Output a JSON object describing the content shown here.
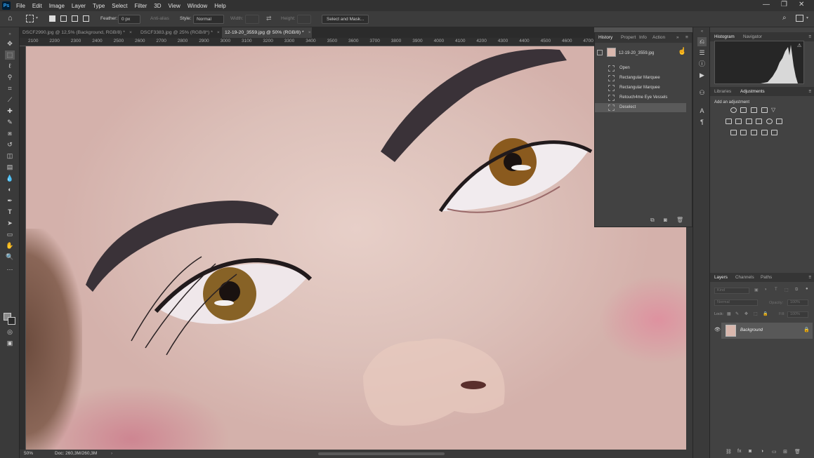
{
  "menubar": {
    "logo": "Ps",
    "items": [
      "File",
      "Edit",
      "Image",
      "Layer",
      "Type",
      "Select",
      "Filter",
      "3D",
      "View",
      "Window",
      "Help"
    ]
  },
  "options": {
    "feather_label": "Feather:",
    "feather_value": "0 px",
    "antialias_label": "Anti-alias",
    "style_label": "Style:",
    "style_value": "Normal",
    "width_label": "Width:",
    "height_label": "Height:",
    "select_mask_button": "Select and Mask..."
  },
  "tabs": [
    {
      "label": "DSCF2990.jpg @ 12,5% (Background, RGB/8) *",
      "close": "×"
    },
    {
      "label": "DSCF3383.jpg @ 25% (RGB/8*) *",
      "close": "×"
    },
    {
      "label": "12-19-20_3559.jpg @ 50% (RGB/8) *",
      "close": "×"
    }
  ],
  "ruler_ticks": [
    "2100",
    "2200",
    "2300",
    "2400",
    "2500",
    "2600",
    "2700",
    "2800",
    "2900",
    "3000",
    "3100",
    "3200",
    "3300",
    "3400",
    "3500",
    "3600",
    "3700",
    "3800",
    "3900",
    "4000",
    "4100",
    "4200",
    "4300",
    "4400",
    "4500",
    "4600",
    "4700"
  ],
  "history": {
    "tabs": [
      "History",
      "Propert",
      "Info",
      "Action"
    ],
    "snapshot_name": "12-19-20_3559.jpg",
    "steps": [
      "Open",
      "Rectangular Marquee",
      "Rectangular Marquee",
      "Retouch4me Eye Vessels",
      "Deselect"
    ],
    "selected_index": 4
  },
  "right_panels": {
    "top_tabs": [
      "Histogram",
      "Navigator"
    ],
    "mid_tabs": [
      "Libraries",
      "Adjustments"
    ],
    "add_adjustment": "Add an adjustment",
    "layers_tabs": [
      "Layers",
      "Channels",
      "Paths"
    ],
    "kind_placeholder": "Kind",
    "blend_mode": "Normal",
    "opacity_label": "Opacity:",
    "opacity_value": "100%",
    "lock_label": "Lock:",
    "fill_label": "Fill:",
    "fill_value": "100%",
    "layer_name": "Background"
  },
  "status": {
    "zoom": "50%",
    "doc": "Doc: 260,3M/260,3M"
  },
  "colors": {
    "menubar": "#323232",
    "panel": "#424242",
    "accent_ps": "#31a8ff"
  }
}
